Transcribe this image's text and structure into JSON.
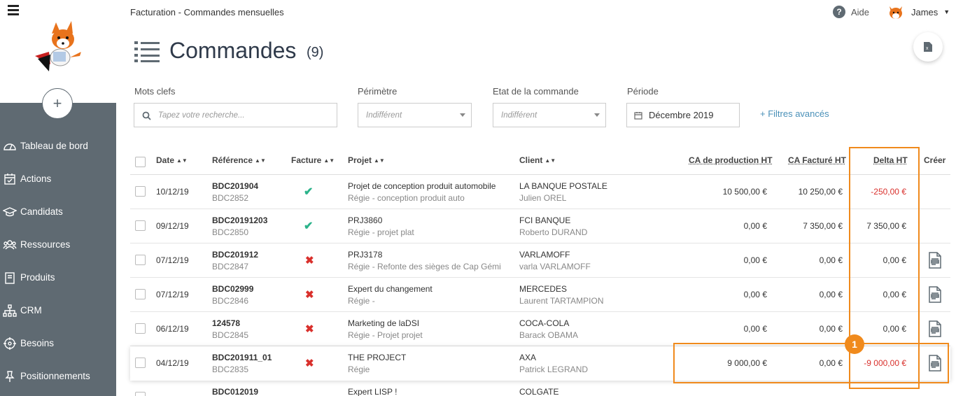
{
  "sidebar": {
    "add_label": "+",
    "items": [
      {
        "label": "Tableau de bord",
        "icon": "dashboard-icon"
      },
      {
        "label": "Actions",
        "icon": "calendar-check-icon"
      },
      {
        "label": "Candidats",
        "icon": "graduation-cap-icon"
      },
      {
        "label": "Ressources",
        "icon": "users-icon"
      },
      {
        "label": "Produits",
        "icon": "book-icon"
      },
      {
        "label": "CRM",
        "icon": "sitemap-icon"
      },
      {
        "label": "Besoins",
        "icon": "target-icon"
      },
      {
        "label": "Positionnements",
        "icon": "pin-icon"
      }
    ]
  },
  "header": {
    "breadcrumb": "Facturation - Commandes mensuelles",
    "help": "Aide",
    "user": "James",
    "title": "Commandes",
    "count": "(9)"
  },
  "filters": {
    "keywords_label": "Mots clefs",
    "keywords_placeholder": "Tapez votre recherche...",
    "perimetre_label": "Périmètre",
    "perimetre_value": "Indifférent",
    "etat_label": "Etat de la commande",
    "etat_value": "Indifférent",
    "periode_label": "Période",
    "periode_value": "Décembre 2019",
    "advanced": "+ Filtres avancés"
  },
  "table": {
    "columns": {
      "date": "Date",
      "reference": "Référence",
      "facture": "Facture",
      "projet": "Projet",
      "client": "Client",
      "ca_prod": "CA de production HT",
      "ca_fact": "CA Facturé HT",
      "delta": "Delta HT",
      "creer": "Créer"
    },
    "rows": [
      {
        "date": "10/12/19",
        "ref": "BDC201904",
        "ref2": "BDC2852",
        "facture": "yes",
        "projet": "Projet de conception produit automobile",
        "projet2": "Régie  - conception produit auto",
        "client": "LA BANQUE POSTALE",
        "client2": "Julien OREL",
        "ca_prod": "10 500,00 €",
        "ca_fact": "10 250,00 €",
        "delta": "-250,00 €",
        "delta_red": true,
        "doc": false
      },
      {
        "date": "09/12/19",
        "ref": "BDC20191203",
        "ref2": "BDC2850",
        "facture": "yes",
        "projet": "PRJ3860",
        "projet2": "Régie  - projet plat",
        "client": "FCI BANQUE",
        "client2": "Roberto DURAND",
        "ca_prod": "0,00 €",
        "ca_fact": "7 350,00 €",
        "delta": "7 350,00 €",
        "delta_red": false,
        "doc": false
      },
      {
        "date": "07/12/19",
        "ref": "BDC201912",
        "ref2": "BDC2847",
        "facture": "no",
        "projet": "PRJ3178",
        "projet2": "Régie  - Refonte des sièges de Cap Gémi",
        "client": "VARLAMOFF",
        "client2": "varla VARLAMOFF",
        "ca_prod": "0,00 €",
        "ca_fact": "0,00 €",
        "delta": "0,00 €",
        "delta_red": false,
        "doc": true
      },
      {
        "date": "07/12/19",
        "ref": "BDC02999",
        "ref2": "BDC2846",
        "facture": "no",
        "projet": "Expert du changement",
        "projet2": "Régie  -",
        "client": "MERCEDES",
        "client2": "Laurent TARTAMPION",
        "ca_prod": "0,00 €",
        "ca_fact": "0,00 €",
        "delta": "0,00 €",
        "delta_red": false,
        "doc": true
      },
      {
        "date": "06/12/19",
        "ref": "124578",
        "ref2": "BDC2845",
        "facture": "no",
        "projet": "Marketing de laDSI",
        "projet2": "Régie  - Projet projet",
        "client": "COCA-COLA",
        "client2": "Barack OBAMA",
        "ca_prod": "0,00 €",
        "ca_fact": "0,00 €",
        "delta": "0,00 €",
        "delta_red": false,
        "doc": true
      },
      {
        "date": "04/12/19",
        "ref": "BDC201911_01",
        "ref2": "BDC2835",
        "facture": "no",
        "projet": "THE PROJECT",
        "projet2": "Régie",
        "client": "AXA",
        "client2": "Patrick LEGRAND",
        "ca_prod": "9 000,00 €",
        "ca_fact": "0,00 €",
        "delta": "-9 000,00 €",
        "delta_red": true,
        "doc": true
      },
      {
        "date": "",
        "ref": "BDC012019",
        "ref2": "",
        "facture": "",
        "projet": "Expert LISP !",
        "projet2": "",
        "client": "COLGATE",
        "client2": "",
        "ca_prod": "",
        "ca_fact": "",
        "delta": "",
        "delta_red": false,
        "doc": false
      }
    ]
  },
  "annotation": {
    "badge": "1"
  },
  "colors": {
    "sidebar": "#5f6a72",
    "accent": "#f08a1c",
    "red": "#d9302c",
    "green": "#2bb38a",
    "link": "#4a90b8"
  }
}
